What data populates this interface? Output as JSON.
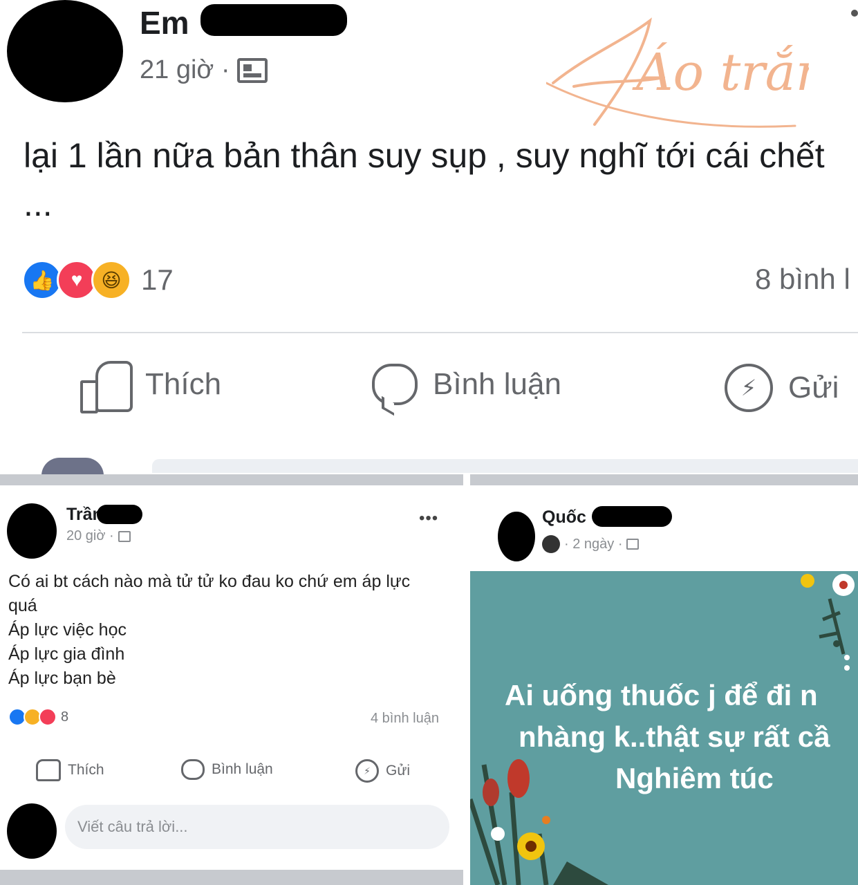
{
  "top_post": {
    "author": "Em",
    "time": "21 giờ ·",
    "text": "lại 1 lần nữa bản thân suy sụp , suy nghĩ tới cái chết ...",
    "reaction_count": "17",
    "comments_count": "8 bình l",
    "actions": {
      "like": "Thích",
      "comment": "Bình luận",
      "send": "Gửi"
    }
  },
  "watermark": "Áo trắng",
  "left_post": {
    "author": "Trần",
    "time": "20 giờ ·",
    "lines": [
      "Có ai bt cách nào mà tử tử ko đau ko chứ em áp lực",
      "quá",
      "Áp lực việc học",
      "Áp lực gia đình",
      "Áp lực bạn bè"
    ],
    "reaction_count": "8",
    "comments_count": "4 bình luận",
    "actions": {
      "like": "Thích",
      "comment": "Bình luận",
      "send": "Gửi"
    },
    "reply_placeholder": "Viết câu trả lời..."
  },
  "right_post": {
    "author": "Quốc",
    "time": "· 2 ngày ·",
    "image_text": [
      "Ai uống thuốc j để đi n",
      "nhàng k..thật sự rất cầ",
      "Nghiêm túc"
    ],
    "image_bg_color": "#5f9ea0"
  },
  "colors": {
    "like_blue": "#1877f2",
    "love_red": "#f33e58",
    "haha_yellow": "#f7b125",
    "watermark_peach": "#f2b48f",
    "separator_gray": "#c7cacf"
  }
}
